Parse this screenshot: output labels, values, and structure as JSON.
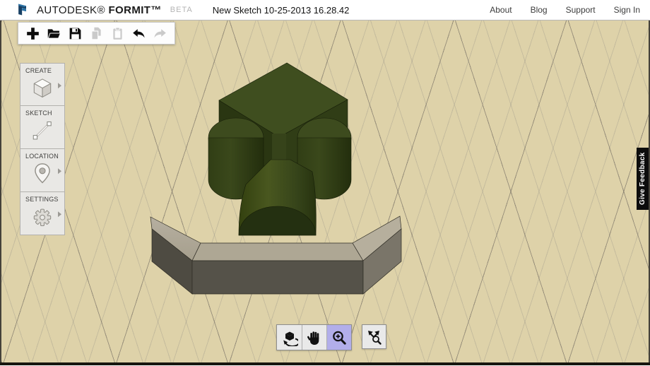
{
  "header": {
    "brand_autodesk": "AUTODESK®",
    "brand_product": "FORMIT™",
    "brand_beta": "BETA",
    "document_title": "New Sketch 10-25-2013 16.28.42",
    "links": [
      {
        "label": "About"
      },
      {
        "label": "Blog"
      },
      {
        "label": "Support"
      },
      {
        "label": "Sign In"
      }
    ]
  },
  "file_toolbar": {
    "buttons": [
      {
        "name": "new-sketch",
        "icon": "plus-icon",
        "enabled": true
      },
      {
        "name": "open",
        "icon": "open-folder-icon",
        "enabled": true
      },
      {
        "name": "save",
        "icon": "floppy-disk-icon",
        "enabled": true
      },
      {
        "name": "copy",
        "icon": "copy-icon",
        "enabled": false
      },
      {
        "name": "paste",
        "icon": "clipboard-icon",
        "enabled": false
      },
      {
        "name": "undo",
        "icon": "undo-arrow-icon",
        "enabled": true
      },
      {
        "name": "redo",
        "icon": "redo-arrow-icon",
        "enabled": false
      }
    ]
  },
  "sidebar": {
    "panels": [
      {
        "label": "CREATE",
        "icon": "cube-icon",
        "has_arrow": true
      },
      {
        "label": "SKETCH",
        "icon": "line-icon",
        "has_arrow": false
      },
      {
        "label": "LOCATION",
        "icon": "map-pin-icon",
        "has_arrow": true
      },
      {
        "label": "SETTINGS",
        "icon": "gear-icon",
        "has_arrow": true
      }
    ]
  },
  "navigation_toolbar": {
    "tools": [
      {
        "name": "orbit",
        "icon": "orbit-icon",
        "active": false
      },
      {
        "name": "pan",
        "icon": "hand-icon",
        "active": false
      },
      {
        "name": "zoom",
        "icon": "zoom-in-icon",
        "active": true
      },
      {
        "name": "zoom-extents",
        "icon": "zoom-extents-icon",
        "active": false
      }
    ],
    "active_tool": "zoom",
    "active_highlight_color": "#b2aeea"
  },
  "feedback_tab": {
    "label": "Give Feedback"
  },
  "canvas": {
    "background_color": "#ded2a9",
    "grid_minor_color": "#c9c3b4",
    "grid_major_color": "#a49c8e",
    "model_objects": [
      {
        "name": "green-blocky-figure",
        "parts": [
          "box",
          "left-cylinder",
          "right-cylinder",
          "half-cylinder-tube"
        ],
        "top_color": "#3c4b1d",
        "side_color": "#2b3713"
      },
      {
        "name": "gray-angled-wall",
        "parts": [
          "left-segment",
          "center-segment",
          "right-segment"
        ],
        "top_color": "#aea794",
        "front_color": "#555249"
      }
    ]
  }
}
